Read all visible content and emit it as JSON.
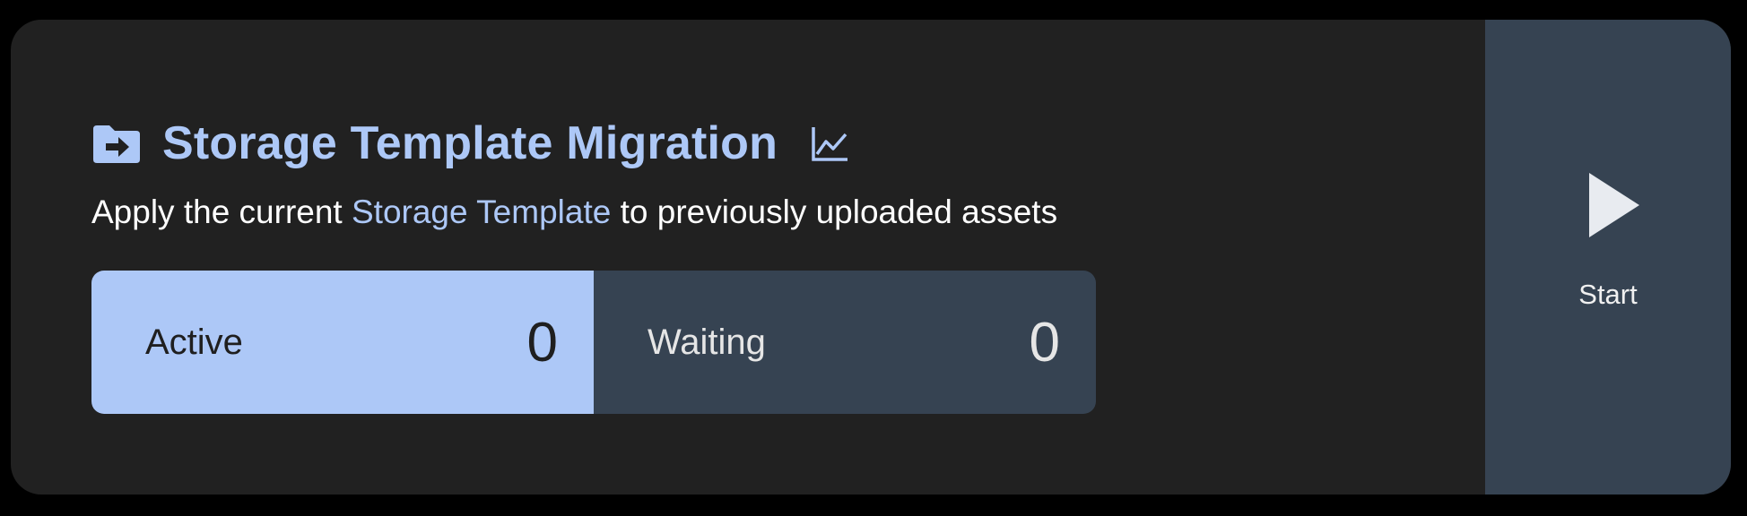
{
  "job": {
    "title": "Storage Template Migration",
    "description_prefix": "Apply the current ",
    "description_link": "Storage Template",
    "description_suffix": " to previously uploaded assets",
    "title_icon": "folder-arrow-icon",
    "stats_icon": "chart-line-icon"
  },
  "stats": {
    "active_label": "Active",
    "active_value": "0",
    "waiting_label": "Waiting",
    "waiting_value": "0"
  },
  "action": {
    "start_label": "Start",
    "icon": "play-icon"
  },
  "colors": {
    "accent": "#adc8f7",
    "card_bg": "#212121",
    "panel_bg": "#364352",
    "page_bg": "#000000"
  }
}
